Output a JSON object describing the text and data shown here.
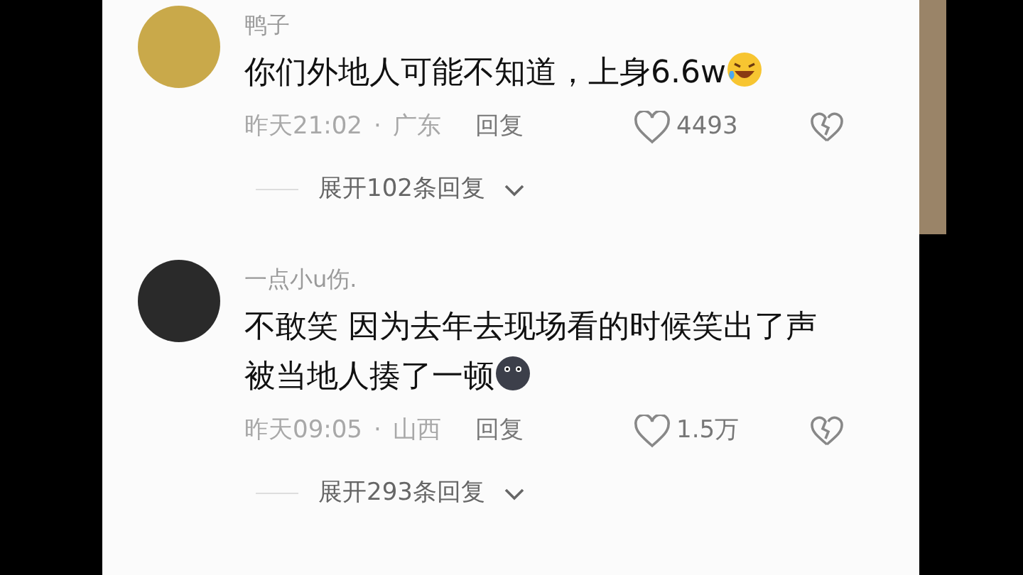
{
  "comments": [
    {
      "username": "鸭子",
      "text_lines": [
        "你们外地人可能不知道，上身6.6w"
      ],
      "time": "昨天21:02",
      "separator": "·",
      "location": "广东",
      "reply": "回复",
      "likes": "4493",
      "expand": "展开102条回复"
    },
    {
      "username": "一点小u伤.",
      "text_lines": [
        "不敢笑 因为去年去现场看的时候笑出了声",
        "被当地人揍了一顿"
      ],
      "time": "昨天09:05",
      "separator": "·",
      "location": "山西",
      "reply": "回复",
      "likes": "1.5万",
      "expand": "展开293条回复"
    }
  ]
}
